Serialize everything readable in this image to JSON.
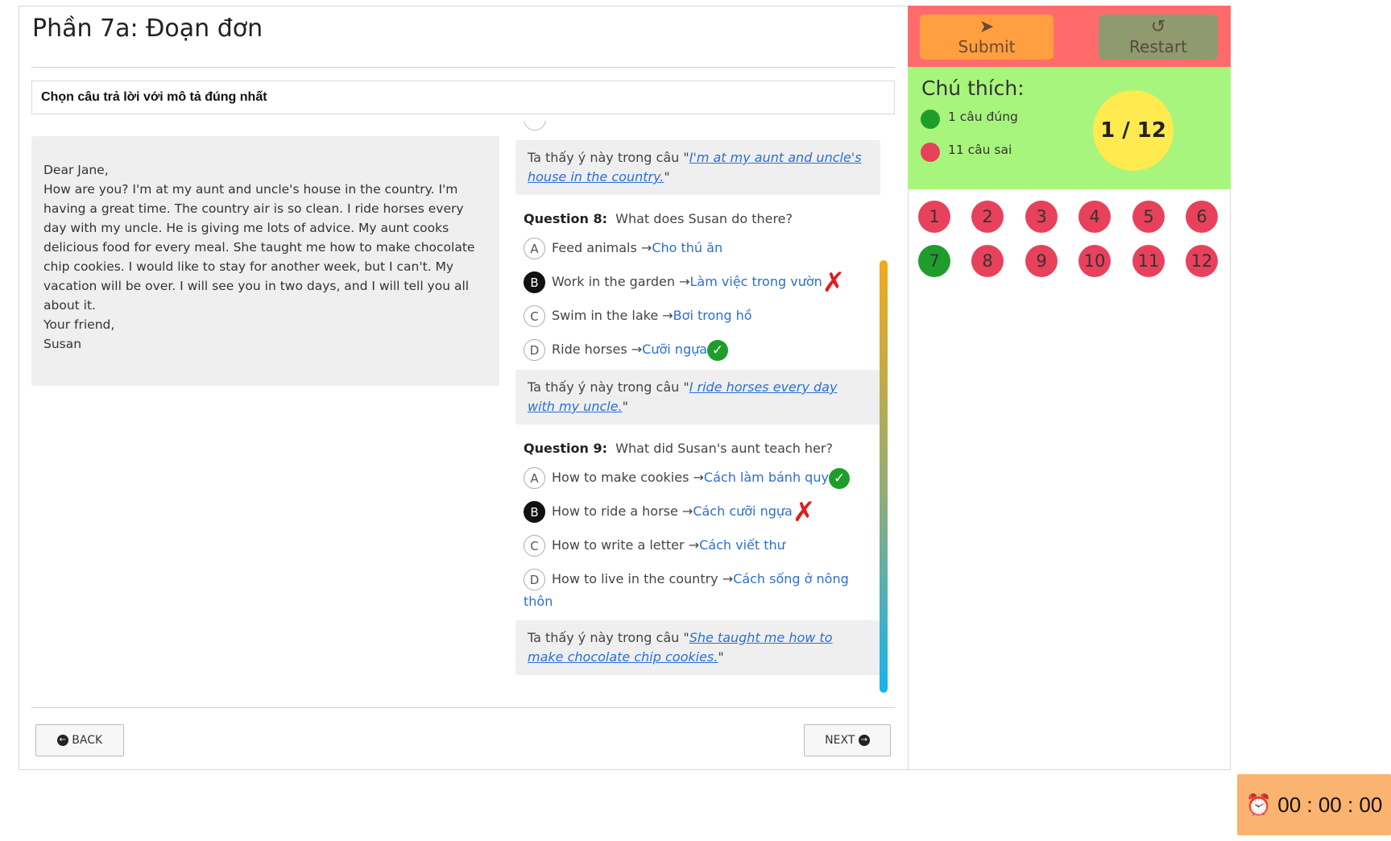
{
  "page": {
    "title": "Phần 7a: Đoạn đơn",
    "instruction": "Chọn câu trả lời với mô tả đúng nhất"
  },
  "passage": {
    "lines": [
      "Dear Jane,",
      "How are you? I'm at my aunt and uncle's house in the country. I'm having a great time. The country air is so clean. I ride horses every day with my uncle. He is giving me lots of advice. My aunt cooks delicious food for every meal. She taught me how to make chocolate chip cookies. I would like to stay for another week, but I can't. My vacation will be over. I will see you in two days, and I will tell you all about it.",
      "Your friend,",
      "Susan"
    ]
  },
  "explanations": {
    "prefix": "Ta thấy ý này trong câu \"",
    "suffix": "\"",
    "q7": "I'm at my aunt and uncle's house in the country.",
    "q8": "I ride horses every day with my uncle.",
    "q9": "She taught me how to make chocolate chip cookies."
  },
  "questions": [
    {
      "label": "Question 8:",
      "text": "What does Susan do there?",
      "options": [
        {
          "letter": "A",
          "text": "Feed animals",
          "translation": "Cho thú ăn",
          "selected": false,
          "mark": ""
        },
        {
          "letter": "B",
          "text": "Work in the garden",
          "translation": "Làm việc trong vườn",
          "selected": true,
          "mark": "wrong"
        },
        {
          "letter": "C",
          "text": "Swim in the lake",
          "translation": "Bơi trong hồ",
          "selected": false,
          "mark": ""
        },
        {
          "letter": "D",
          "text": "Ride horses",
          "translation": "Cưỡi ngựa",
          "selected": false,
          "mark": "correct"
        }
      ]
    },
    {
      "label": "Question 9:",
      "text": "What did Susan's aunt teach her?",
      "options": [
        {
          "letter": "A",
          "text": "How to make cookies",
          "translation": "Cách làm bánh quy",
          "selected": false,
          "mark": "correct"
        },
        {
          "letter": "B",
          "text": "How to ride a horse",
          "translation": "Cách cưỡi ngựa",
          "selected": true,
          "mark": "wrong"
        },
        {
          "letter": "C",
          "text": "How to write a letter",
          "translation": "Cách viết thư",
          "selected": false,
          "mark": ""
        },
        {
          "letter": "D",
          "text": "How to live in the country",
          "translation": "Cách sống ở nông thôn",
          "selected": false,
          "mark": ""
        }
      ]
    }
  ],
  "nav": {
    "back": "BACK",
    "next": "NEXT"
  },
  "sidebar": {
    "submit": "Submit",
    "restart": "Restart",
    "legend_title": "Chú thích:",
    "correct_label": "1 câu đúng",
    "wrong_label": "11 câu sai",
    "score": "1 / 12",
    "question_numbers": [
      "1",
      "2",
      "3",
      "4",
      "5",
      "6",
      "7",
      "8",
      "9",
      "10",
      "11",
      "12"
    ],
    "correct_questions": [
      "7"
    ]
  },
  "timer": {
    "value": "00 : 00 : 00"
  },
  "colors": {
    "header_bg": "#ff6b6b",
    "submit_bg": "#ff9f40",
    "restart_bg": "#8f9a6e",
    "legend_bg": "#a8f57d",
    "correct": "#1f9d2b",
    "wrong": "#e8415c",
    "score_bg": "#ffea4f",
    "timer_bg": "#fbb370",
    "link": "#2a6fd6"
  },
  "icons": {
    "submit": "send-icon",
    "restart": "restart-icon",
    "back": "arrow-left-circle-icon",
    "next": "arrow-right-circle-icon",
    "timer": "alarm-clock-icon",
    "correct_mark": "check-circle-icon",
    "wrong_mark": "cross-icon"
  }
}
